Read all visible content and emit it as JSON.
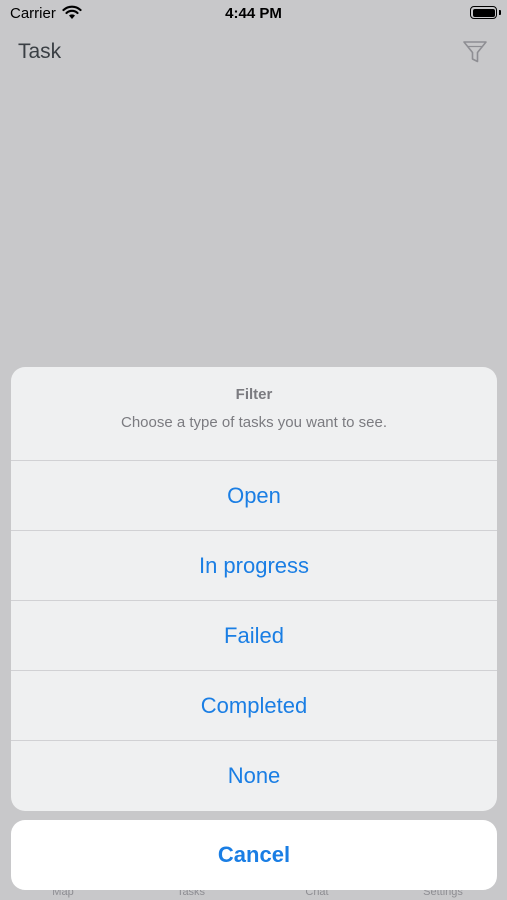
{
  "status_bar": {
    "carrier": "Carrier",
    "time": "4:44 PM"
  },
  "nav": {
    "title": "Task",
    "filter_icon": "filter-icon"
  },
  "tab_bar": {
    "items": [
      "Map",
      "Tasks",
      "Chat",
      "Settings"
    ]
  },
  "action_sheet": {
    "title": "Filter",
    "message": "Choose a type of tasks you want to see.",
    "options": [
      "Open",
      "In progress",
      "Failed",
      "Completed",
      "None"
    ],
    "cancel": "Cancel"
  },
  "colors": {
    "accent": "#1a7ee4",
    "dim_background": "#c8c8ca",
    "sheet_background": "#eff0f1"
  }
}
